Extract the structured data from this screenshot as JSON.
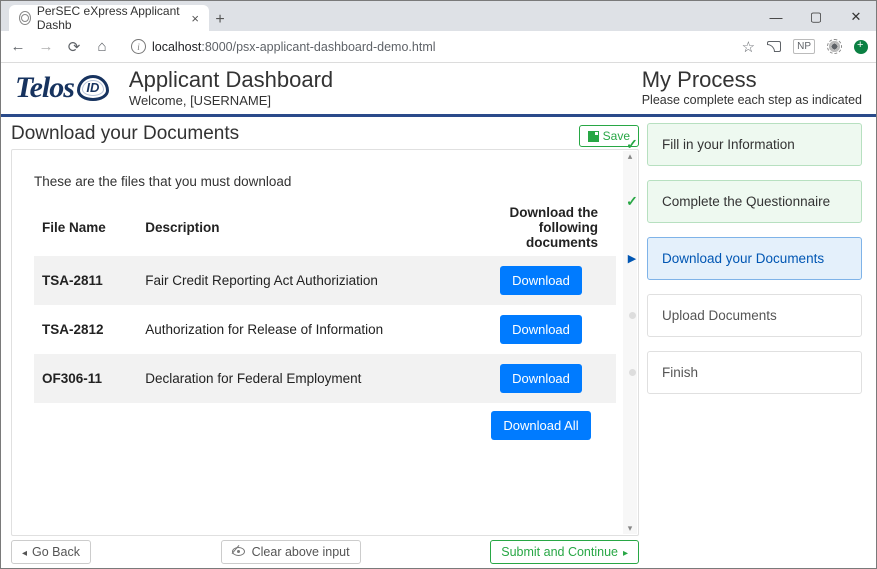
{
  "browser": {
    "tab_title": "PerSEC eXpress Applicant Dashb",
    "url_host": "localhost",
    "url_port": ":8000",
    "url_path": "/psx-applicant-dashboard-demo.html",
    "np": "NP"
  },
  "header": {
    "logo_main": "Telos",
    "logo_badge": "ID",
    "title": "Applicant Dashboard",
    "welcome": "Welcome, [USERNAME]",
    "process_title": "My Process",
    "process_sub": "Please complete each step as indicated"
  },
  "page": {
    "title": "Download your Documents",
    "save": "Save",
    "intro": "These are the files that you must download",
    "col_file": "File Name",
    "col_desc": "Description",
    "col_dl": "Download the following documents",
    "download": "Download",
    "download_all": "Download All"
  },
  "docs": [
    {
      "name": "TSA-2811",
      "desc": "Fair Credit Reporting Act Authoriziation"
    },
    {
      "name": "TSA-2812",
      "desc": "Authorization for Release of Information"
    },
    {
      "name": "OF306-11",
      "desc": "Declaration for Federal Employment"
    }
  ],
  "footer": {
    "back": "Go Back",
    "clear": "Clear above input",
    "next": "Submit and Continue"
  },
  "steps": [
    {
      "label": "Fill in your Information",
      "state": "done"
    },
    {
      "label": "Complete the Questionnaire",
      "state": "done"
    },
    {
      "label": "Download your Documents",
      "state": "active"
    },
    {
      "label": "Upload Documents",
      "state": "pending"
    },
    {
      "label": "Finish",
      "state": "pending"
    }
  ]
}
